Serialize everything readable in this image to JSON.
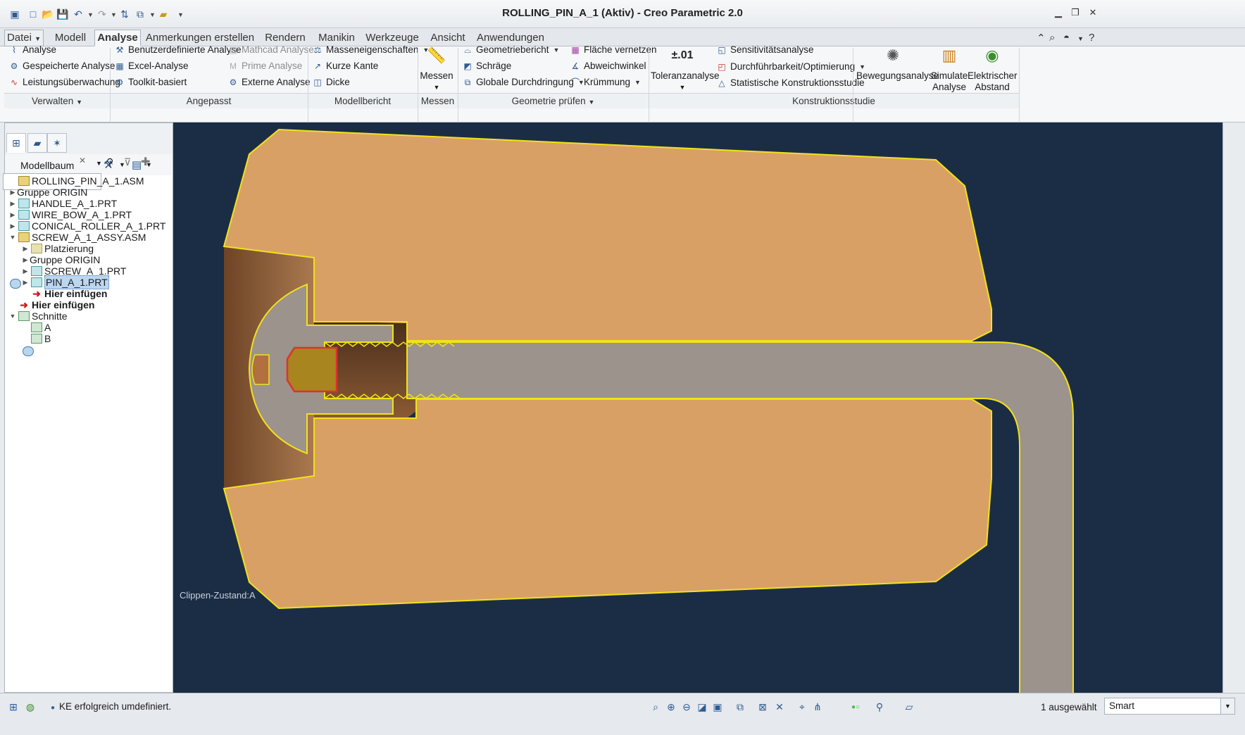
{
  "window": {
    "title": "ROLLING_PIN_A_1 (Aktiv) - Creo Parametric 2.0",
    "controls": [
      "minimize-icon",
      "restore-icon",
      "close-icon"
    ]
  },
  "quick_access": [
    "app-icon",
    "new-icon",
    "open-icon",
    "save-icon",
    "undo-icon",
    "redo-icon",
    "regenerate-icon",
    "windows-icon",
    "folder-icon"
  ],
  "tabs": [
    {
      "label": "Datei"
    },
    {
      "label": "Modell"
    },
    {
      "label": "Analyse"
    },
    {
      "label": "Anmerkungen erstellen"
    },
    {
      "label": "Rendern"
    },
    {
      "label": "Manikin"
    },
    {
      "label": "Werkzeuge"
    },
    {
      "label": "Ansicht"
    },
    {
      "label": "Anwendungen"
    }
  ],
  "active_tab": "Analyse",
  "ribbon": {
    "verwalten": {
      "items": [
        "Analyse",
        "Gespeicherte Analyse",
        "Leistungsüberwachung"
      ],
      "group": "Verwalten"
    },
    "angepasst": {
      "items": [
        "Benutzerdefinierte Analyse",
        "Excel-Analyse",
        "Toolkit-basiert"
      ],
      "items_b": [
        "Mathcad Analyse",
        "Prime Analyse",
        "Externe Analyse"
      ],
      "group": "Angepasst"
    },
    "modellbericht": {
      "items": [
        "Masseneigenschaften",
        "Kurze Kante",
        "Dicke"
      ],
      "group": "Modellbericht"
    },
    "messen": {
      "big": "Messen",
      "group": "Messen"
    },
    "geometrie": {
      "items": [
        "Geometriebericht",
        "Schräge",
        "Globale Durchdringung"
      ],
      "items_b": [
        "Fläche vernetzen",
        "Abweichwinkel",
        "Krümmung"
      ],
      "group": "Geometrie prüfen"
    },
    "konstruktion": {
      "toleranz_icon": "±.01",
      "toleranz": "Toleranzanalyse",
      "items": [
        "Sensitivitätsanalyse",
        "Durchführbarkeit/Optimierung",
        "Statistische Konstruktionsstudie"
      ],
      "bewegung": "Bewegungsanalyse",
      "simulate": [
        "Simulate",
        "Analyse"
      ],
      "elektrisch": [
        "Elektrischer",
        "Abstand"
      ],
      "group": "Konstruktionsstudie"
    }
  },
  "panel": {
    "title": "Modellbaum",
    "search": {
      "value": "",
      "placeholder": ""
    },
    "tree": [
      {
        "label": "ROLLING_PIN_A_1.ASM",
        "level": 0,
        "toggle": "",
        "icon": "asm"
      },
      {
        "label": "Gruppe ORIGIN",
        "level": 0,
        "toggle": "▶",
        "icon": "grp"
      },
      {
        "label": "HANDLE_A_1.PRT",
        "level": 0,
        "toggle": "▶",
        "icon": "prt"
      },
      {
        "label": "WIRE_BOW_A_1.PRT",
        "level": 0,
        "toggle": "▶",
        "icon": "prt"
      },
      {
        "label": "CONICAL_ROLLER_A_1.PRT",
        "level": 0,
        "toggle": "▶",
        "icon": "prt"
      },
      {
        "label": "SCREW_A_1_ASSY.ASM",
        "level": 0,
        "toggle": "▼",
        "icon": "asm"
      },
      {
        "label": "Platzierung",
        "level": 1,
        "toggle": "▶",
        "icon": "plc"
      },
      {
        "label": "Gruppe ORIGIN",
        "level": 1,
        "toggle": "▶",
        "icon": "grp"
      },
      {
        "label": "SCREW_A_1.PRT",
        "level": 1,
        "toggle": "▶",
        "icon": "prt"
      },
      {
        "label": "PIN_A_1.PRT",
        "level": 1,
        "toggle": "▶",
        "icon": "prt",
        "selected": true
      },
      {
        "label": "Hier einfügen",
        "level": 1,
        "toggle": "",
        "icon": "ins"
      },
      {
        "label": "Hier einfügen",
        "level": 0,
        "toggle": "",
        "icon": "ins"
      },
      {
        "label": "Schnitte",
        "level": 0,
        "toggle": "▼",
        "icon": "sec"
      },
      {
        "label": "A",
        "level": 1,
        "toggle": "",
        "icon": "sec"
      },
      {
        "label": "B",
        "level": 1,
        "toggle": "",
        "icon": "sec"
      }
    ]
  },
  "graphics": {
    "clip_state": "Clippen-Zustand:A",
    "colors": {
      "background": "#1b2d45",
      "roller": "#d9a066",
      "roller_dark": "#8a5a33",
      "steel": "#9c938c",
      "pin": "#a8851f",
      "outline": "#f2e21a",
      "selection": "#e03030"
    }
  },
  "status": {
    "message": "KE erfolgreich umdefiniert.",
    "selection": "1 ausgewählt",
    "filter": "Smart"
  }
}
